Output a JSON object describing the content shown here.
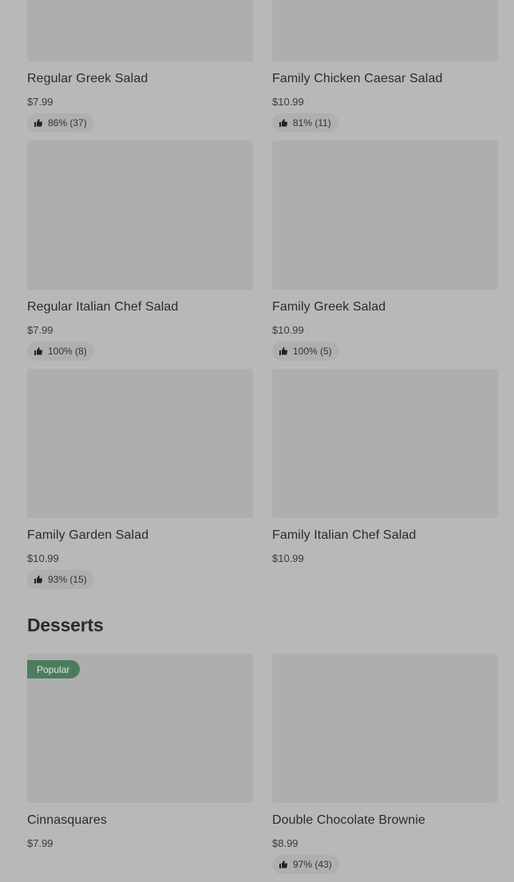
{
  "salads": [
    {
      "name": "Regular Greek Salad",
      "price": "$7.99",
      "rating": "86% (37)"
    },
    {
      "name": "Family Chicken Caesar Salad",
      "price": "$10.99",
      "rating": "81% (11)"
    },
    {
      "name": "Regular Italian Chef Salad",
      "price": "$7.99",
      "rating": "100% (8)"
    },
    {
      "name": "Family Greek Salad",
      "price": "$10.99",
      "rating": "100% (5)"
    },
    {
      "name": "Family Garden Salad",
      "price": "$10.99",
      "rating": "93% (15)"
    },
    {
      "name": "Family Italian Chef Salad",
      "price": "$10.99"
    }
  ],
  "desserts_section": {
    "title": "Desserts",
    "items": [
      {
        "name": "Cinnasquares",
        "price": "$7.99",
        "badge": "Popular"
      },
      {
        "name": "Double Chocolate Brownie",
        "price": "$8.99",
        "rating": "97% (43)"
      }
    ]
  },
  "colors": {
    "background": "#b8b8b8",
    "image_placeholder": "#aeaeae",
    "popular_badge": "#4b7d5d"
  },
  "icons": {
    "rating": "thumbs-up-icon"
  }
}
